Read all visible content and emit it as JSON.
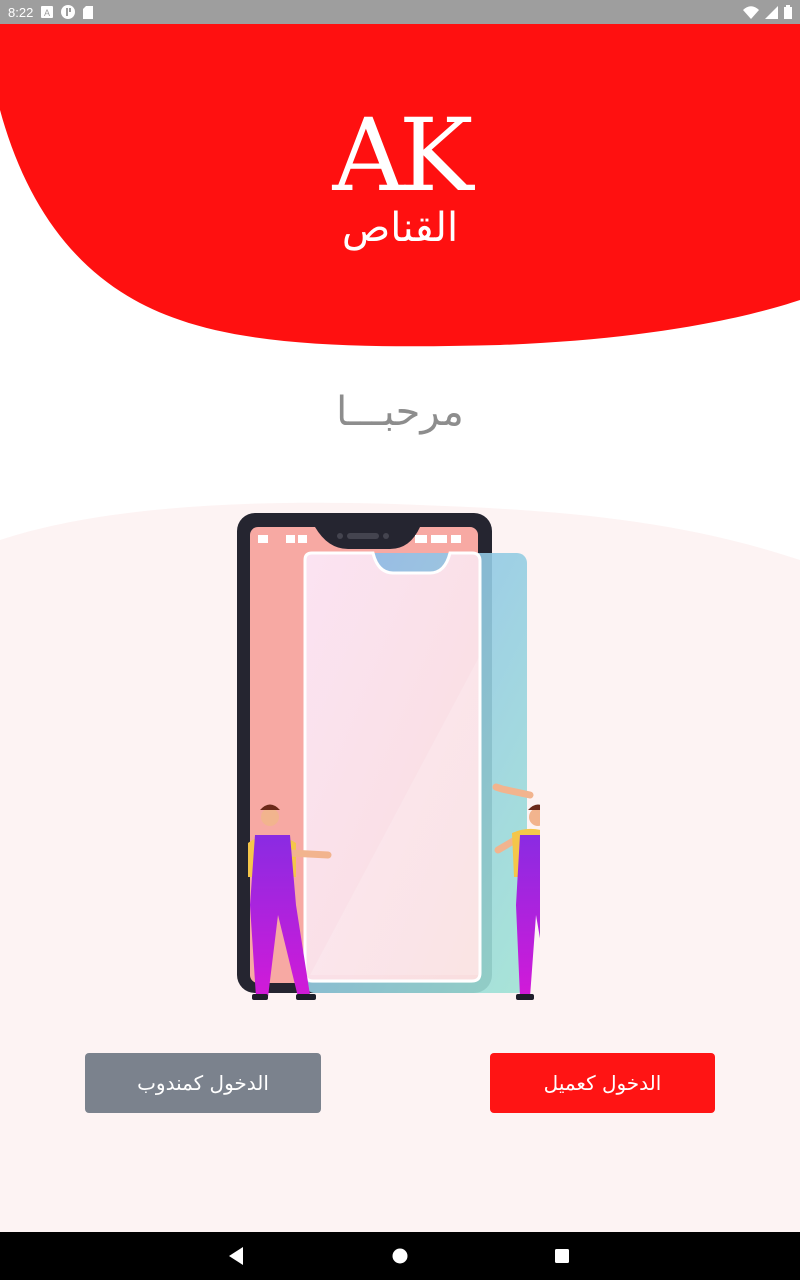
{
  "status_bar": {
    "time": "8:22",
    "icons": [
      "accessibility-icon",
      "app-icon",
      "sd-card-icon",
      "wifi-icon",
      "signal-icon",
      "battery-icon"
    ]
  },
  "logo": {
    "mark": "AK",
    "subtitle": "القناص"
  },
  "welcome_text": "مرحبـــا",
  "buttons": {
    "agent_login": "الدخول كمندوب",
    "client_login": "الدخول كعميل"
  },
  "colors": {
    "brand_red": "#ff1414",
    "gray_button": "#7b828d",
    "welcome_gray": "#8d8d8d"
  },
  "nav_bar": {
    "icons": [
      "back-icon",
      "home-icon",
      "recents-icon"
    ]
  }
}
